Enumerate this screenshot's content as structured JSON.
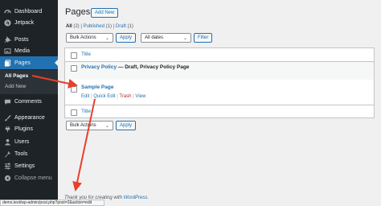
{
  "sidebar": {
    "items": [
      {
        "label": "Dashboard",
        "icon": "dashboard-icon"
      },
      {
        "label": "Jetpack",
        "icon": "jetpack-icon"
      },
      {
        "label": "Posts",
        "icon": "pin-icon"
      },
      {
        "label": "Media",
        "icon": "media-icon"
      },
      {
        "label": "Pages",
        "icon": "pages-icon"
      },
      {
        "label": "Comments",
        "icon": "comment-icon"
      },
      {
        "label": "Appearance",
        "icon": "brush-icon"
      },
      {
        "label": "Plugins",
        "icon": "plugin-icon"
      },
      {
        "label": "Users",
        "icon": "user-icon"
      },
      {
        "label": "Tools",
        "icon": "wrench-icon"
      },
      {
        "label": "Settings",
        "icon": "settings-icon"
      },
      {
        "label": "Collapse menu",
        "icon": "collapse-icon"
      }
    ],
    "submenu": [
      "All Pages",
      "Add New"
    ]
  },
  "page": {
    "title": "Pages",
    "add_new": "Add New",
    "filters": {
      "all": "All",
      "all_count": "(2)",
      "published": "Published",
      "published_count": "(1)",
      "draft": "Draft",
      "draft_count": "(1)"
    },
    "bulk_actions": "Bulk Actions",
    "apply": "Apply",
    "all_dates": "All dates",
    "filter": "Filter"
  },
  "table": {
    "header": "Title",
    "rows": [
      {
        "title": "Privacy Policy",
        "state": " — Draft, Privacy Policy Page"
      },
      {
        "title": "Sample Page",
        "actions": [
          "Edit",
          "Quick Edit",
          "Trash",
          "View"
        ]
      }
    ],
    "footer": "Title"
  },
  "footer": {
    "thanks": "Thank you for creating with ",
    "wordpress": "WordPress."
  },
  "status_url": "demo.test/wp-admin/post.php?post=2&action=edit",
  "colors": {
    "sidebar": "#1d2327",
    "accent": "#2271b1",
    "arrow": "#e8402a"
  }
}
